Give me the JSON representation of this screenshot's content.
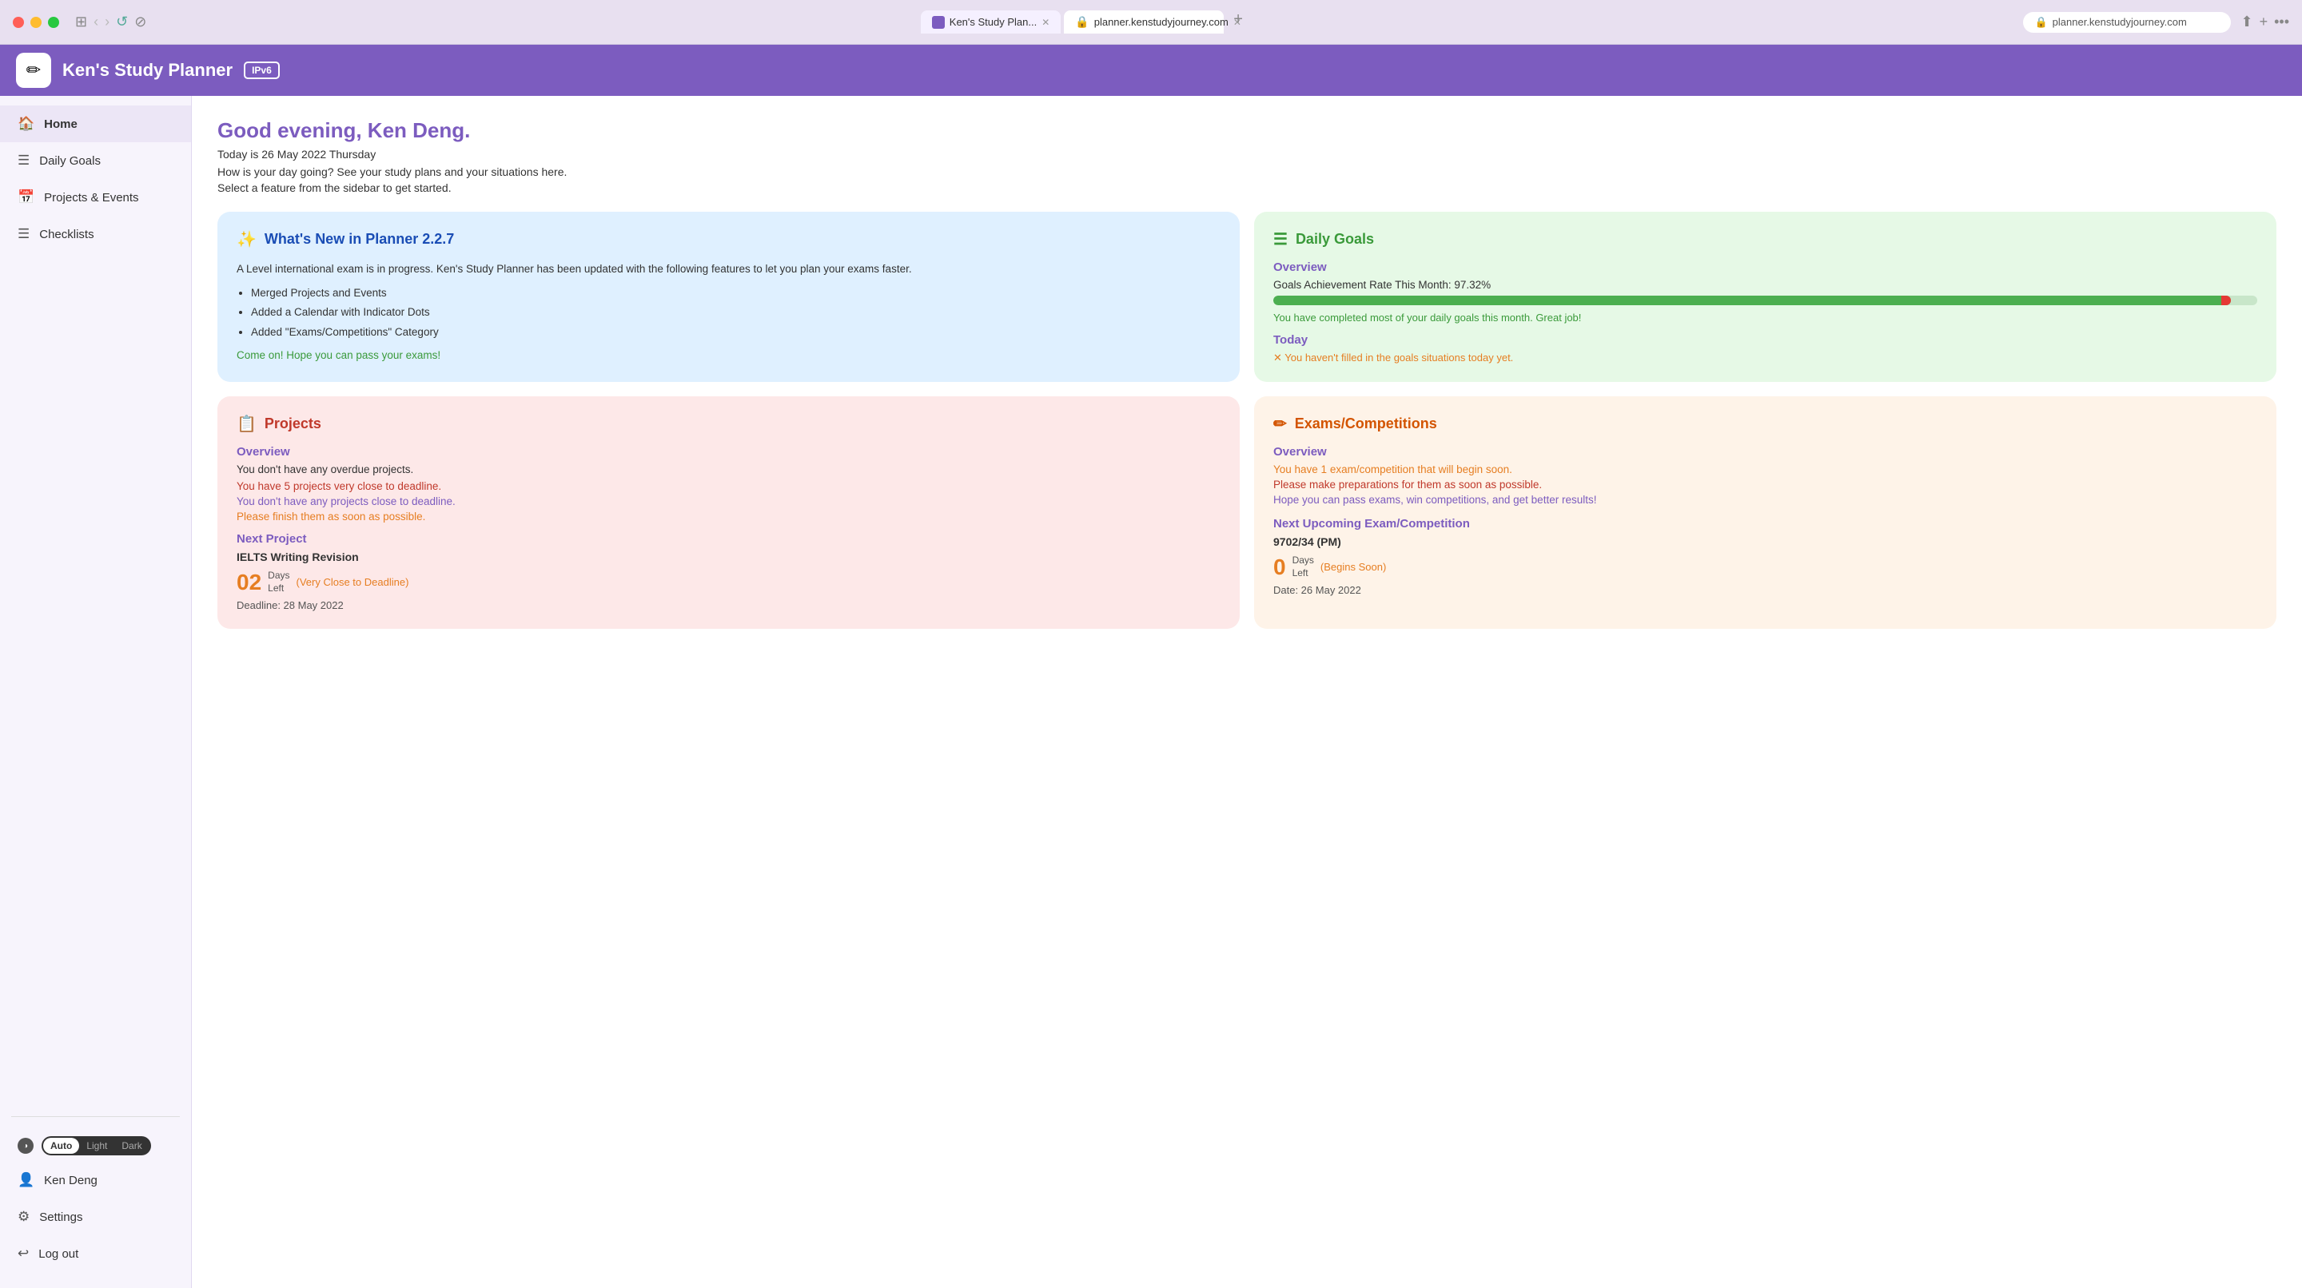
{
  "browser": {
    "tab1_label": "Ken's Study Plan...",
    "tab2_label": "planner.kenstudyjourney.com",
    "address": "planner.kenstudyjourney.com"
  },
  "header": {
    "app_title": "Ken's Study Planner",
    "ipv6_badge": "IPv6",
    "logo_icon": "✏"
  },
  "sidebar": {
    "items": [
      {
        "label": "Home",
        "icon": "🏠"
      },
      {
        "label": "Daily Goals",
        "icon": "☰"
      },
      {
        "label": "Projects & Events",
        "icon": "📅"
      },
      {
        "label": "Checklists",
        "icon": "☰"
      }
    ],
    "bottom_items": [
      {
        "label": "Ken Deng",
        "icon": "👤"
      },
      {
        "label": "Settings",
        "icon": "⚙"
      },
      {
        "label": "Log out",
        "icon": "↩"
      }
    ],
    "theme": {
      "options": [
        "Auto",
        "Light",
        "Dark"
      ],
      "active": "Auto"
    }
  },
  "content": {
    "greeting": "Good evening, Ken Deng.",
    "date": "Today is 26 May 2022 Thursday",
    "sub": "How is your day going? See your study plans and your situations here.",
    "start": "Select a feature from the sidebar to get started."
  },
  "whats_new": {
    "title": "What's New in Planner 2.2.7",
    "icon": "✨",
    "body": "A Level international exam is in progress. Ken's Study Planner has been updated with the following features to let you plan your exams faster.",
    "bullets": [
      "Merged Projects and Events",
      "Added a Calendar with Indicator Dots",
      "Added \"Exams/Competitions\" Category"
    ],
    "cta": "Come on! Hope you can pass your exams!"
  },
  "daily_goals": {
    "title": "Daily Goals",
    "icon": "☰",
    "overview_header": "Overview",
    "rate_text": "Goals Achievement Rate This Month: 97.32%",
    "progress_pct": 97.32,
    "congrat": "You have completed most of your daily goals this month. Great job!",
    "today_header": "Today",
    "today_warning": "✕ You haven't filled in the goals situations today yet."
  },
  "projects": {
    "title": "Projects",
    "icon": "📋",
    "overview_header": "Overview",
    "ok": "You don't have any overdue projects.",
    "warn1": "You have 5 projects very close to deadline.",
    "warn2": "You don't have any projects close to deadline.",
    "urgent": "Please finish them as soon as possible.",
    "next_header": "Next Project",
    "next_name": "IELTS Writing Revision",
    "days_num": "02",
    "days_label1": "Days",
    "days_label2": "Left",
    "very_close": "(Very Close to Deadline)",
    "deadline": "Deadline: 28 May 2022"
  },
  "exams": {
    "title": "Exams/Competitions",
    "icon": "✏",
    "overview_header": "Overview",
    "warn1": "You have 1 exam/competition that will begin soon.",
    "urgent": "Please make preparations for them as soon as possible.",
    "hope": "Hope you can pass exams, win competitions, and get better results!",
    "next_header": "Next Upcoming Exam/Competition",
    "next_name": "9702/34 (PM)",
    "days_num": "0",
    "days_label1": "Days",
    "days_label2": "Left",
    "begins": "(Begins Soon)",
    "date": "Date: 26 May 2022"
  }
}
